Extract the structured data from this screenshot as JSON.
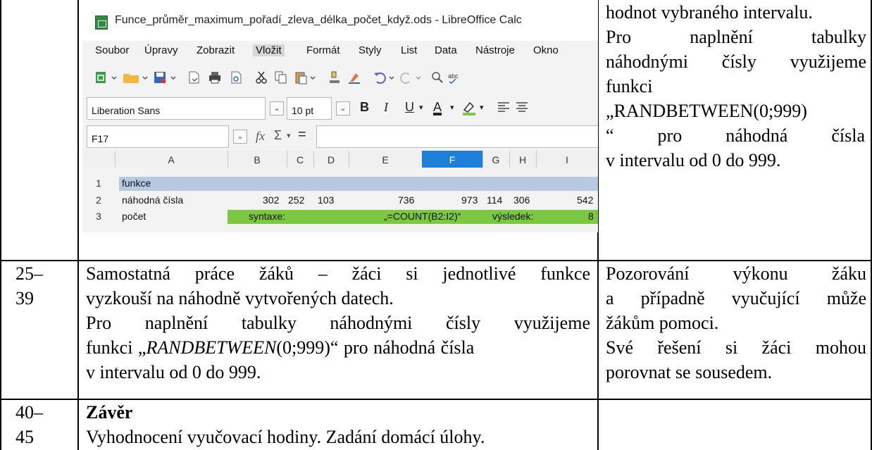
{
  "screenshot": {
    "window_title": "Funce_průměr_maximum_pořadí_zleva_délka_počet_když.ods - LibreOffice Calc",
    "menu": [
      "Soubor",
      "Úpravy",
      "Zobrazit",
      "Vložit",
      "Formát",
      "Styly",
      "List",
      "Data",
      "Nástroje",
      "Okno"
    ],
    "font_name": "Liberation Sans",
    "font_size": "10 pt",
    "name_box": "F17",
    "fx": "fx",
    "sum": "Σ",
    "equals": "=",
    "columns": [
      "A",
      "B",
      "C",
      "D",
      "E",
      "F",
      "G",
      "H",
      "I"
    ],
    "rows": [
      {
        "num": "1",
        "a": "funkce"
      },
      {
        "num": "2",
        "a": "náhodná čísla",
        "values": [
          "302",
          "252",
          "103",
          "736",
          "973",
          "114",
          "306",
          "542"
        ]
      },
      {
        "num": "3",
        "a": "počet",
        "syntax_label": "syntaxe:",
        "syntax": "„=COUNT(B2:I2)“",
        "result_label": "výsledek:",
        "result": "8"
      }
    ],
    "colors": {
      "row1": "#b7c9e2",
      "row3": "#7dc843",
      "selected_col": "#1e7fd8"
    }
  },
  "top_right": {
    "lines": [
      "hodnot vybraného intervalu.",
      "Pro naplnění tabulky",
      "náhodnými čísly využijeme",
      "funkci",
      "„RANDBETWEEN(0;999)",
      "“ pro náhodná čísla",
      "v intervalu od 0 do 999."
    ]
  },
  "row2": {
    "time": [
      "25–",
      "39"
    ],
    "main_lines": [
      "Samostatná práce žáků – žáci si jednotlivé funkce",
      "vyzkouší na náhodně vytvořených datech.",
      "Pro naplnění tabulky náhodnými čísly využijeme",
      "funkci „",
      "RANDBETWEEN",
      "(0;999)“ pro náhodná čísla",
      "v intervalu od 0 do 999."
    ],
    "right_lines": [
      "Pozorování výkonu žáku",
      "a případně vyučující může",
      "žákům pomoci.",
      "Své řešení si žáci mohou",
      "porovnat se sousedem."
    ]
  },
  "row3": {
    "time": [
      "40–",
      "45"
    ],
    "heading": "Závěr",
    "text": "Vyhodnocení vyučovací hodiny. Zadání domácí úlohy."
  }
}
